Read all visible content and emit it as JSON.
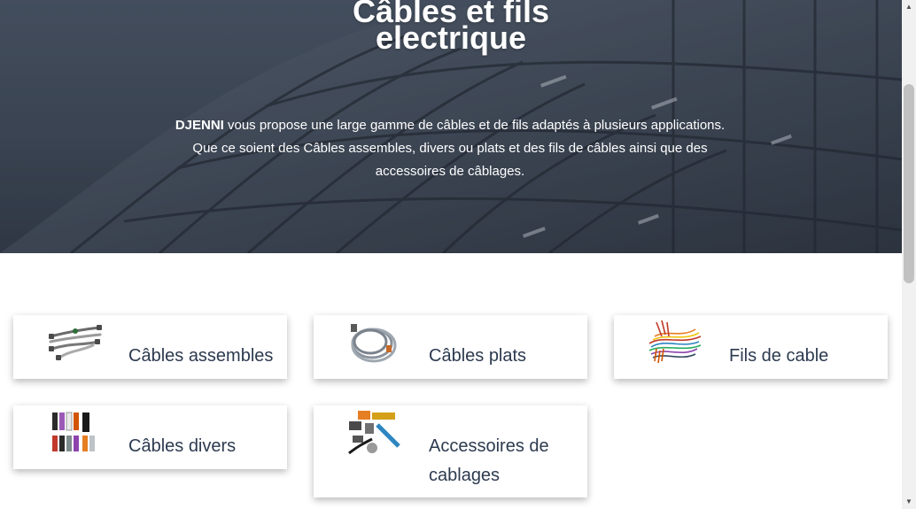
{
  "hero": {
    "title_line1": "Câbles et fils",
    "title_line2": "electrique",
    "brand": "DJENNI",
    "text_line1": " vous propose une large gamme de câbles et de fils adaptés à plusieurs applications.",
    "text_line2": "Que ce soient des Câbles assembles, divers ou plats et des fils de câbles ainsi que des",
    "text_line3": "accessoires de câblages."
  },
  "categories": [
    {
      "label": "Câbles assembles",
      "icon": "assembled-cables-image"
    },
    {
      "label": "Câbles plats",
      "icon": "flat-cable-image"
    },
    {
      "label": "Fils de cable",
      "icon": "cable-wires-image"
    },
    {
      "label": "Câbles divers",
      "icon": "misc-cables-image"
    },
    {
      "label_line1": "Accessoires de",
      "label_line2": "cablages",
      "icon": "wiring-accessories-image"
    }
  ],
  "colors": {
    "label": "#2c3a4f",
    "hero_overlay": "#3d4756"
  }
}
